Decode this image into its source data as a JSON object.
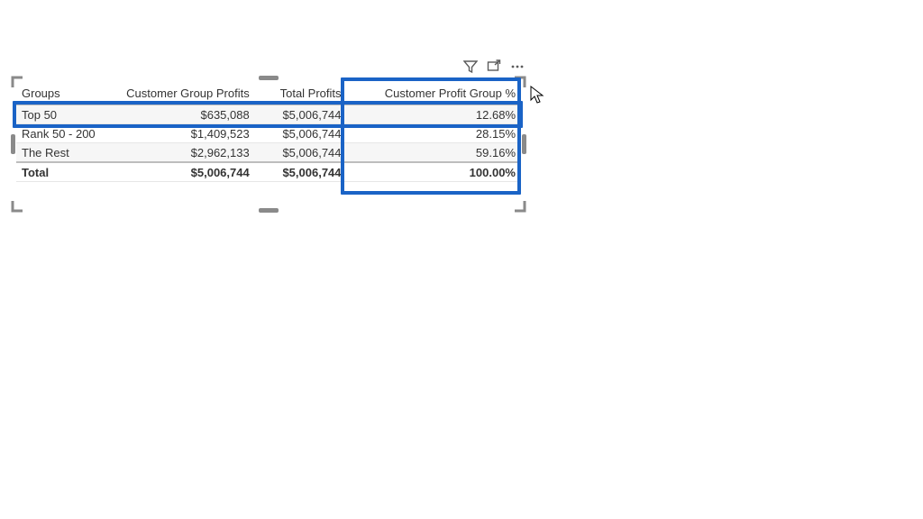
{
  "visual_actions": {
    "filter_tooltip": "Filters",
    "focus_tooltip": "Focus mode",
    "more_tooltip": "More options"
  },
  "table": {
    "headers": {
      "groups": "Groups",
      "cgp": "Customer Group Profits",
      "tp": "Total Profits",
      "cpgp": "Customer Profit Group %"
    },
    "rows": [
      {
        "groups": "Top 50",
        "cgp": "$635,088",
        "tp": "$5,006,744",
        "cpgp": "12.68%"
      },
      {
        "groups": "Rank 50 - 200",
        "cgp": "$1,409,523",
        "tp": "$5,006,744",
        "cpgp": "28.15%"
      },
      {
        "groups": "The Rest",
        "cgp": "$2,962,133",
        "tp": "$5,006,744",
        "cpgp": "59.16%"
      }
    ],
    "footer": {
      "groups": "Total",
      "cgp": "$5,006,744",
      "tp": "$5,006,744",
      "cpgp": "100.00%"
    }
  },
  "chart_data": {
    "type": "table",
    "title": "",
    "columns": [
      "Groups",
      "Customer Group Profits",
      "Total Profits",
      "Customer Profit Group %"
    ],
    "rows": [
      [
        "Top 50",
        635088,
        5006744,
        12.68
      ],
      [
        "Rank 50 - 200",
        1409523,
        5006744,
        28.15
      ],
      [
        "The Rest",
        2962133,
        5006744,
        59.16
      ]
    ],
    "footer": [
      "Total",
      5006744,
      5006744,
      100.0
    ]
  }
}
